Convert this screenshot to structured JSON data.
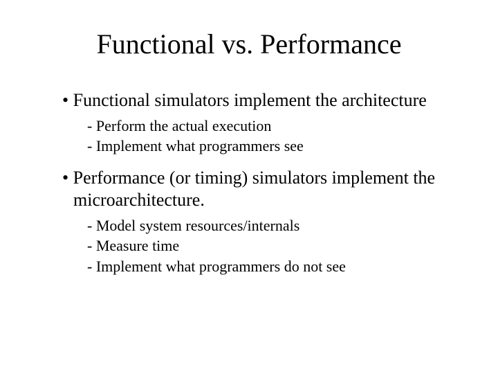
{
  "title": "Functional vs. Performance",
  "bullets": [
    {
      "text": "Functional simulators implement the architecture",
      "sub": [
        "Perform the actual execution",
        "Implement what programmers see"
      ]
    },
    {
      "text": "Performance (or timing) simulators implement the microarchitecture.",
      "sub": [
        "Model system resources/internals",
        "Measure time",
        "Implement what programmers do not see"
      ]
    }
  ]
}
